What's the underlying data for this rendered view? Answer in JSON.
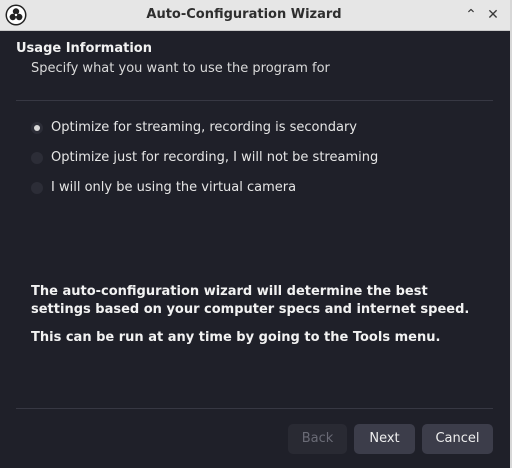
{
  "window": {
    "title": "Auto-Configuration Wizard",
    "app_icon": "obs-logo-icon",
    "titlebar_buttons": {
      "minimize_glyph": "⌃",
      "close_glyph": "✕"
    }
  },
  "page": {
    "heading": "Usage Information",
    "subheading": "Specify what you want to use the program for"
  },
  "usage_options": [
    {
      "label": "Optimize for streaming, recording is secondary",
      "checked": true
    },
    {
      "label": "Optimize just for recording, I will not be streaming",
      "checked": false
    },
    {
      "label": "I will only be using the virtual camera",
      "checked": false
    }
  ],
  "info": {
    "line1": "The auto-configuration wizard will determine the best settings based on your computer specs and internet speed.",
    "line2": "This can be run at any time by going to the Tools menu."
  },
  "buttons": {
    "back": "Back",
    "next": "Next",
    "cancel": "Cancel"
  },
  "colors": {
    "background": "#1f2029",
    "titlebar": "#e6e6e6",
    "button": "#3c3d4a",
    "button_disabled": "#292a33"
  }
}
